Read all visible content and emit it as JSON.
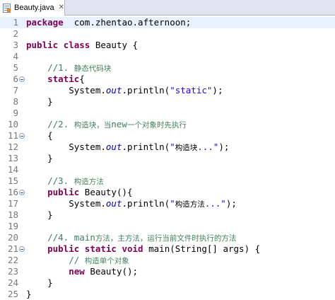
{
  "tab": {
    "title": "Beauty.java",
    "close": "✕"
  },
  "lines": [
    {
      "n": "1",
      "seg": [
        [
          "kw",
          "package"
        ],
        [
          "",
          "  com.zhentao.afternoon;"
        ]
      ]
    },
    {
      "n": "2",
      "seg": []
    },
    {
      "n": "3",
      "seg": [
        [
          "kw",
          "public"
        ],
        [
          "",
          " "
        ],
        [
          "kw",
          "class"
        ],
        [
          "",
          " Beauty {"
        ]
      ]
    },
    {
      "n": "4",
      "seg": []
    },
    {
      "n": "5",
      "seg": [
        [
          "",
          "    "
        ],
        [
          "cm",
          "//1. "
        ],
        [
          "cmcn",
          "静态代码块"
        ]
      ]
    },
    {
      "n": "6",
      "fold": true,
      "seg": [
        [
          "",
          "    "
        ],
        [
          "kw",
          "static"
        ],
        [
          "",
          "{"
        ]
      ]
    },
    {
      "n": "7",
      "seg": [
        [
          "",
          "        System."
        ],
        [
          "fld",
          "out"
        ],
        [
          "",
          ".println("
        ],
        [
          "st",
          "\"static\""
        ],
        [
          "",
          ");"
        ]
      ]
    },
    {
      "n": "8",
      "seg": [
        [
          "",
          "    }"
        ]
      ]
    },
    {
      "n": "9",
      "seg": []
    },
    {
      "n": "10",
      "seg": [
        [
          "",
          "    "
        ],
        [
          "cm",
          "//2. "
        ],
        [
          "cmcn",
          "构造块，当"
        ],
        [
          "cm",
          "new"
        ],
        [
          "cmcn",
          "一个对象时先执行"
        ]
      ]
    },
    {
      "n": "11",
      "fold": true,
      "seg": [
        [
          "",
          "    {"
        ]
      ]
    },
    {
      "n": "12",
      "seg": [
        [
          "",
          "        System."
        ],
        [
          "fld",
          "out"
        ],
        [
          "",
          ".println("
        ],
        [
          "st",
          "\""
        ],
        [
          "stcn",
          "构造块"
        ],
        [
          "st",
          "...\""
        ],
        [
          "",
          ");"
        ]
      ]
    },
    {
      "n": "13",
      "seg": [
        [
          "",
          "    }"
        ]
      ]
    },
    {
      "n": "14",
      "seg": []
    },
    {
      "n": "15",
      "seg": [
        [
          "",
          "    "
        ],
        [
          "cm",
          "//3. "
        ],
        [
          "cmcn",
          "构造方法"
        ]
      ]
    },
    {
      "n": "16",
      "fold": true,
      "seg": [
        [
          "",
          "    "
        ],
        [
          "kw",
          "public"
        ],
        [
          "",
          " Beauty(){"
        ]
      ]
    },
    {
      "n": "17",
      "seg": [
        [
          "",
          "        System."
        ],
        [
          "fld",
          "out"
        ],
        [
          "",
          ".println("
        ],
        [
          "st",
          "\""
        ],
        [
          "stcn",
          "构造方法"
        ],
        [
          "st",
          "...\""
        ],
        [
          "",
          ");"
        ]
      ]
    },
    {
      "n": "18",
      "seg": [
        [
          "",
          "    }"
        ]
      ]
    },
    {
      "n": "19",
      "seg": []
    },
    {
      "n": "20",
      "seg": [
        [
          "",
          "    "
        ],
        [
          "cm",
          "//4. main"
        ],
        [
          "cmcn",
          "方法，主方法，运行当前文件时执行的方法"
        ]
      ]
    },
    {
      "n": "21",
      "fold": true,
      "seg": [
        [
          "",
          "    "
        ],
        [
          "kw",
          "public"
        ],
        [
          "",
          " "
        ],
        [
          "kw",
          "static"
        ],
        [
          "",
          " "
        ],
        [
          "kw",
          "void"
        ],
        [
          "",
          " main(String[] args) {"
        ]
      ]
    },
    {
      "n": "22",
      "seg": [
        [
          "",
          "        "
        ],
        [
          "cm",
          "// "
        ],
        [
          "cmcn",
          "构造单个对象"
        ]
      ]
    },
    {
      "n": "23",
      "seg": [
        [
          "",
          "        "
        ],
        [
          "kw",
          "new"
        ],
        [
          "",
          " Beauty();"
        ]
      ]
    },
    {
      "n": "24",
      "seg": [
        [
          "",
          "    }"
        ]
      ]
    },
    {
      "n": "25",
      "seg": [
        [
          "",
          "}"
        ]
      ]
    }
  ],
  "current_line": "1",
  "colors": {
    "keyword": "#7f0055",
    "comment": "#3f7f5f",
    "string": "#2a00ff",
    "field": "#0000c0"
  }
}
